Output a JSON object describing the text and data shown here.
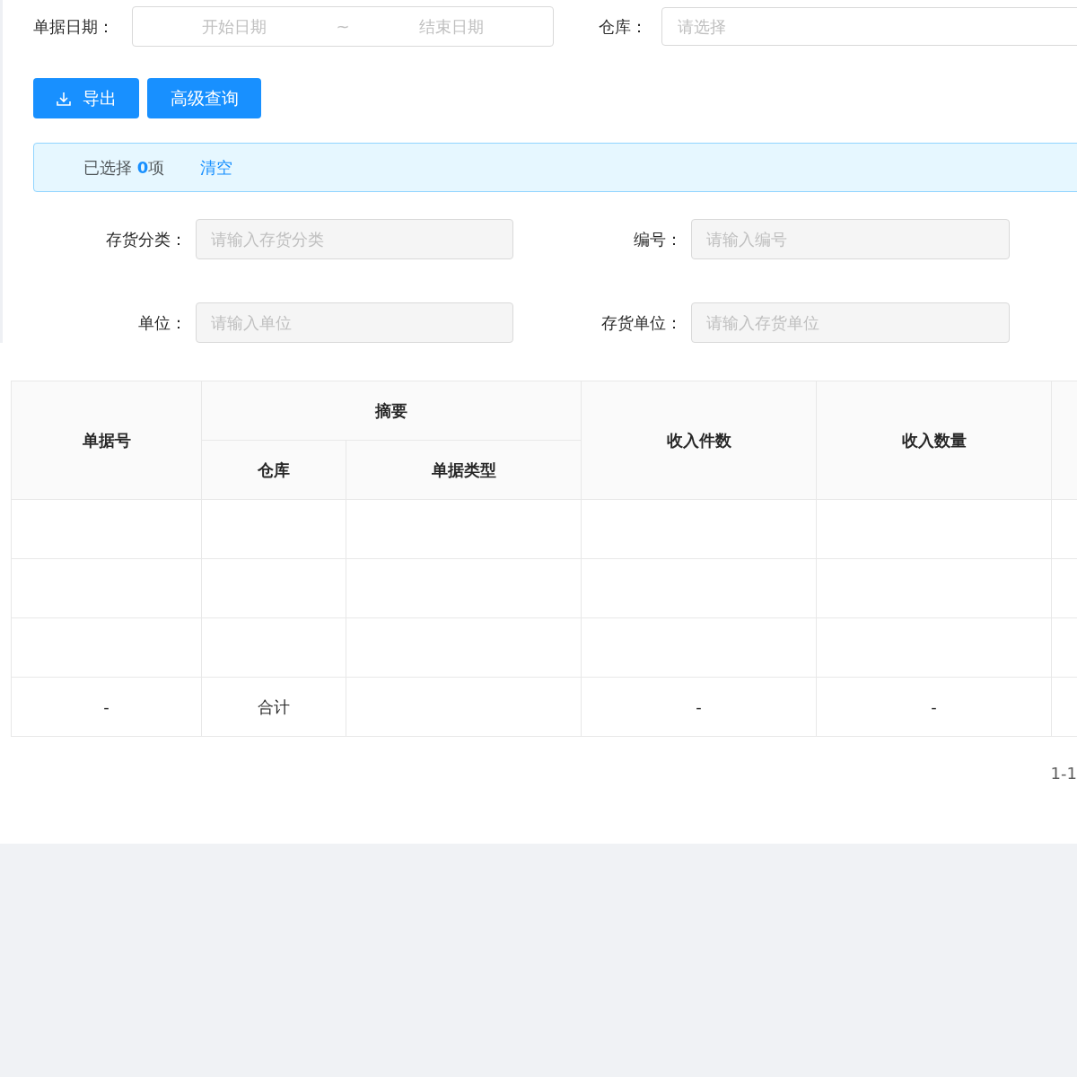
{
  "filters": {
    "date_label": "单据日期：",
    "start_placeholder": "开始日期",
    "separator": "~",
    "end_placeholder": "结束日期",
    "warehouse_label": "仓库：",
    "warehouse_placeholder": "请选择"
  },
  "buttons": [
    {
      "label": "导出",
      "kind": "export"
    },
    {
      "label": "高级查询",
      "kind": "plain"
    }
  ],
  "selection_bar": {
    "text": "已选择 **0**项",
    "clear_link": "清空"
  },
  "form_fields": [
    {
      "label": "存货分类：",
      "placeholder": "请输入存货分类",
      "disabled": true
    },
    {
      "label": "编号：",
      "placeholder": "请输入编号",
      "disabled": true
    },
    {
      "label": "单位：",
      "placeholder": "请输入单位",
      "disabled": true
    },
    {
      "label": "存货单位：",
      "placeholder": "请输入存货单位",
      "disabled": true
    }
  ],
  "table": {
    "columns": {
      "bill_no": "单据号",
      "summary": "摘要",
      "warehouse": "仓库",
      "bill_type": "单据类型",
      "income_pieces": "收入件数",
      "income_qty": "收入数量"
    },
    "rows": [
      {
        "kind": "blank"
      },
      {
        "kind": "blank"
      },
      {
        "kind": "blank"
      }
    ],
    "total_row": {
      "bill_no": "-",
      "warehouse": "合计",
      "income_pieces": "-",
      "income_qty": "-"
    }
  },
  "pagination": {
    "range": "1-1"
  }
}
